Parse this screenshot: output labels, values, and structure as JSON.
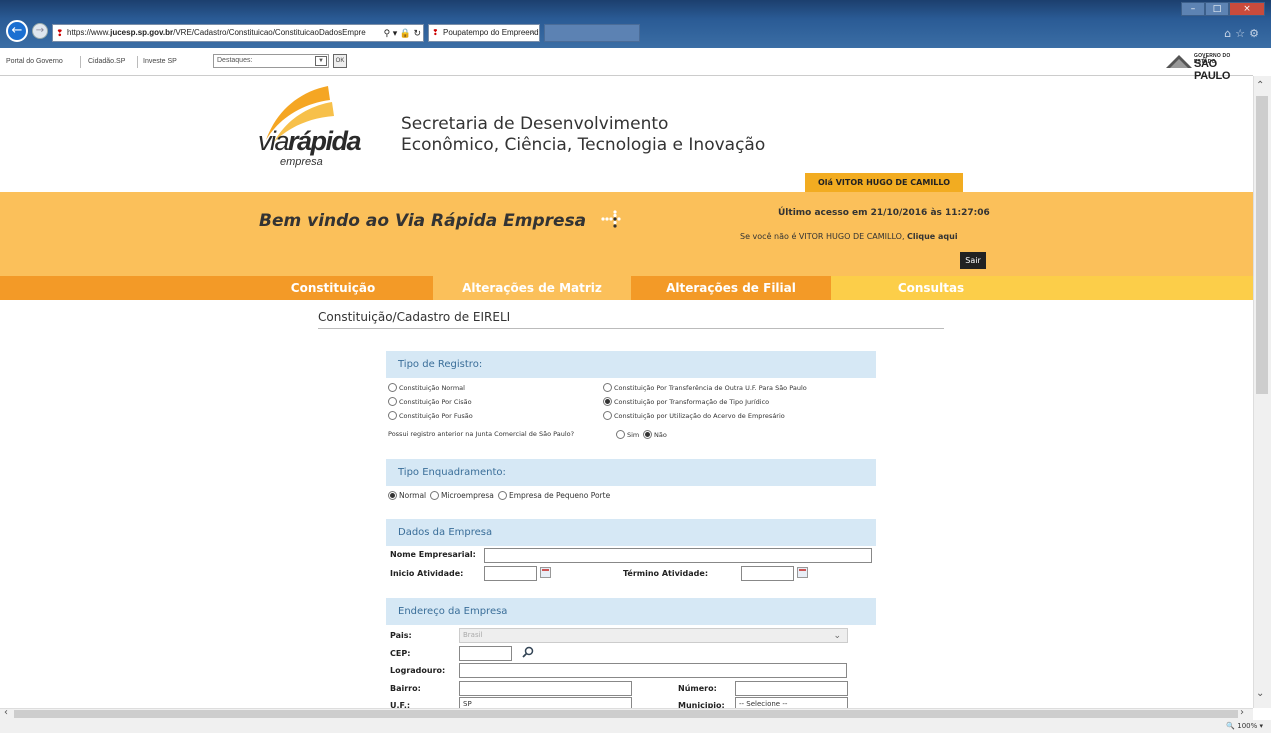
{
  "browser": {
    "url_prefix": "https://www.",
    "url_domain": "jucesp.sp.gov.br",
    "url_path": "/VRE/Cadastro/Constituicao/ConstituicaoDadosEmpre",
    "active_tab": "Poupatempo do Empreend...",
    "zoom": "100%",
    "colors": {
      "back_button": "#1b6fd1",
      "titlebar": "#2a5b95"
    }
  },
  "govbar": {
    "links": [
      "Portal do Governo",
      "Cidadão.SP",
      "Investe SP"
    ],
    "destaques_value": "Destaques:",
    "ok_label": "OK",
    "logo_line1": "GOVERNO DO ESTADO",
    "logo_line2": "SÃO PAULO"
  },
  "header": {
    "logo_pre": "via",
    "logo_bold": "rápida",
    "logo_sub": "empresa",
    "secretaria_line1": "Secretaria de Desenvolvimento",
    "secretaria_line2": "Econômico, Ciência, Tecnologia e Inovação",
    "hello": "Olá VITOR HUGO DE CAMILLO",
    "welcome": "Bem vindo ao Via Rápida Empresa",
    "last_access": "Último acesso em 21/10/2016 às 11:27:06",
    "not_you_prefix": "Se você não é VITOR HUGO DE CAMILLO, ",
    "not_you_link": "Clique aqui",
    "logout_label": "Sair",
    "colors": {
      "welcome_bar": "#fbc05a",
      "hello_tab": "#f2ac21"
    }
  },
  "nav": {
    "items": [
      {
        "label": "Constituição",
        "color": "#f39a27"
      },
      {
        "label": "Alterações de Matriz",
        "color": "#fbc05a"
      },
      {
        "label": "Alterações de Filial",
        "color": "#f39a27"
      },
      {
        "label": "Consultas",
        "color": "#fcce49"
      }
    ]
  },
  "page": {
    "title": "Constituição/Cadastro de EIRELI"
  },
  "tipo_registro": {
    "heading": "Tipo de Registro:",
    "options_left": [
      "Constituição Normal",
      "Constituição Por Cisão",
      "Constituição Por Fusão"
    ],
    "options_right": [
      "Constituição Por Transferência de Outra U.F. Para São Paulo",
      "Constituição por Transformação de Tipo Jurídico",
      "Constituição por Utilização do Acervo de Empresário"
    ],
    "selected": "Constituição por Transformação de Tipo Jurídico",
    "question": "Possui registro anterior na Junta Comercial de São Paulo?",
    "answers": [
      "Sim",
      "Não"
    ],
    "answer_selected": "Não"
  },
  "tipo_enquadramento": {
    "heading": "Tipo Enquadramento:",
    "options": [
      "Normal",
      "Microempresa",
      "Empresa de Pequeno Porte"
    ],
    "selected": "Normal"
  },
  "dados_empresa": {
    "heading": "Dados da Empresa",
    "nome_label": "Nome Empresarial:",
    "nome_value": "",
    "inicio_label": "Inicio Atividade:",
    "inicio_value": "",
    "termino_label": "Término Atividade:",
    "termino_value": ""
  },
  "endereco": {
    "heading": "Endereço da Empresa",
    "pais_label": "Pais:",
    "pais_value": "Brasil",
    "cep_label": "CEP:",
    "cep_value": "",
    "logradouro_label": "Logradouro:",
    "logradouro_value": "",
    "bairro_label": "Bairro:",
    "bairro_value": "",
    "numero_label": "Número:",
    "numero_value": "",
    "uf_label": "U.F.:",
    "uf_value": "SP",
    "municipio_label": "Municipio:",
    "municipio_value": "-- Selecione --"
  }
}
